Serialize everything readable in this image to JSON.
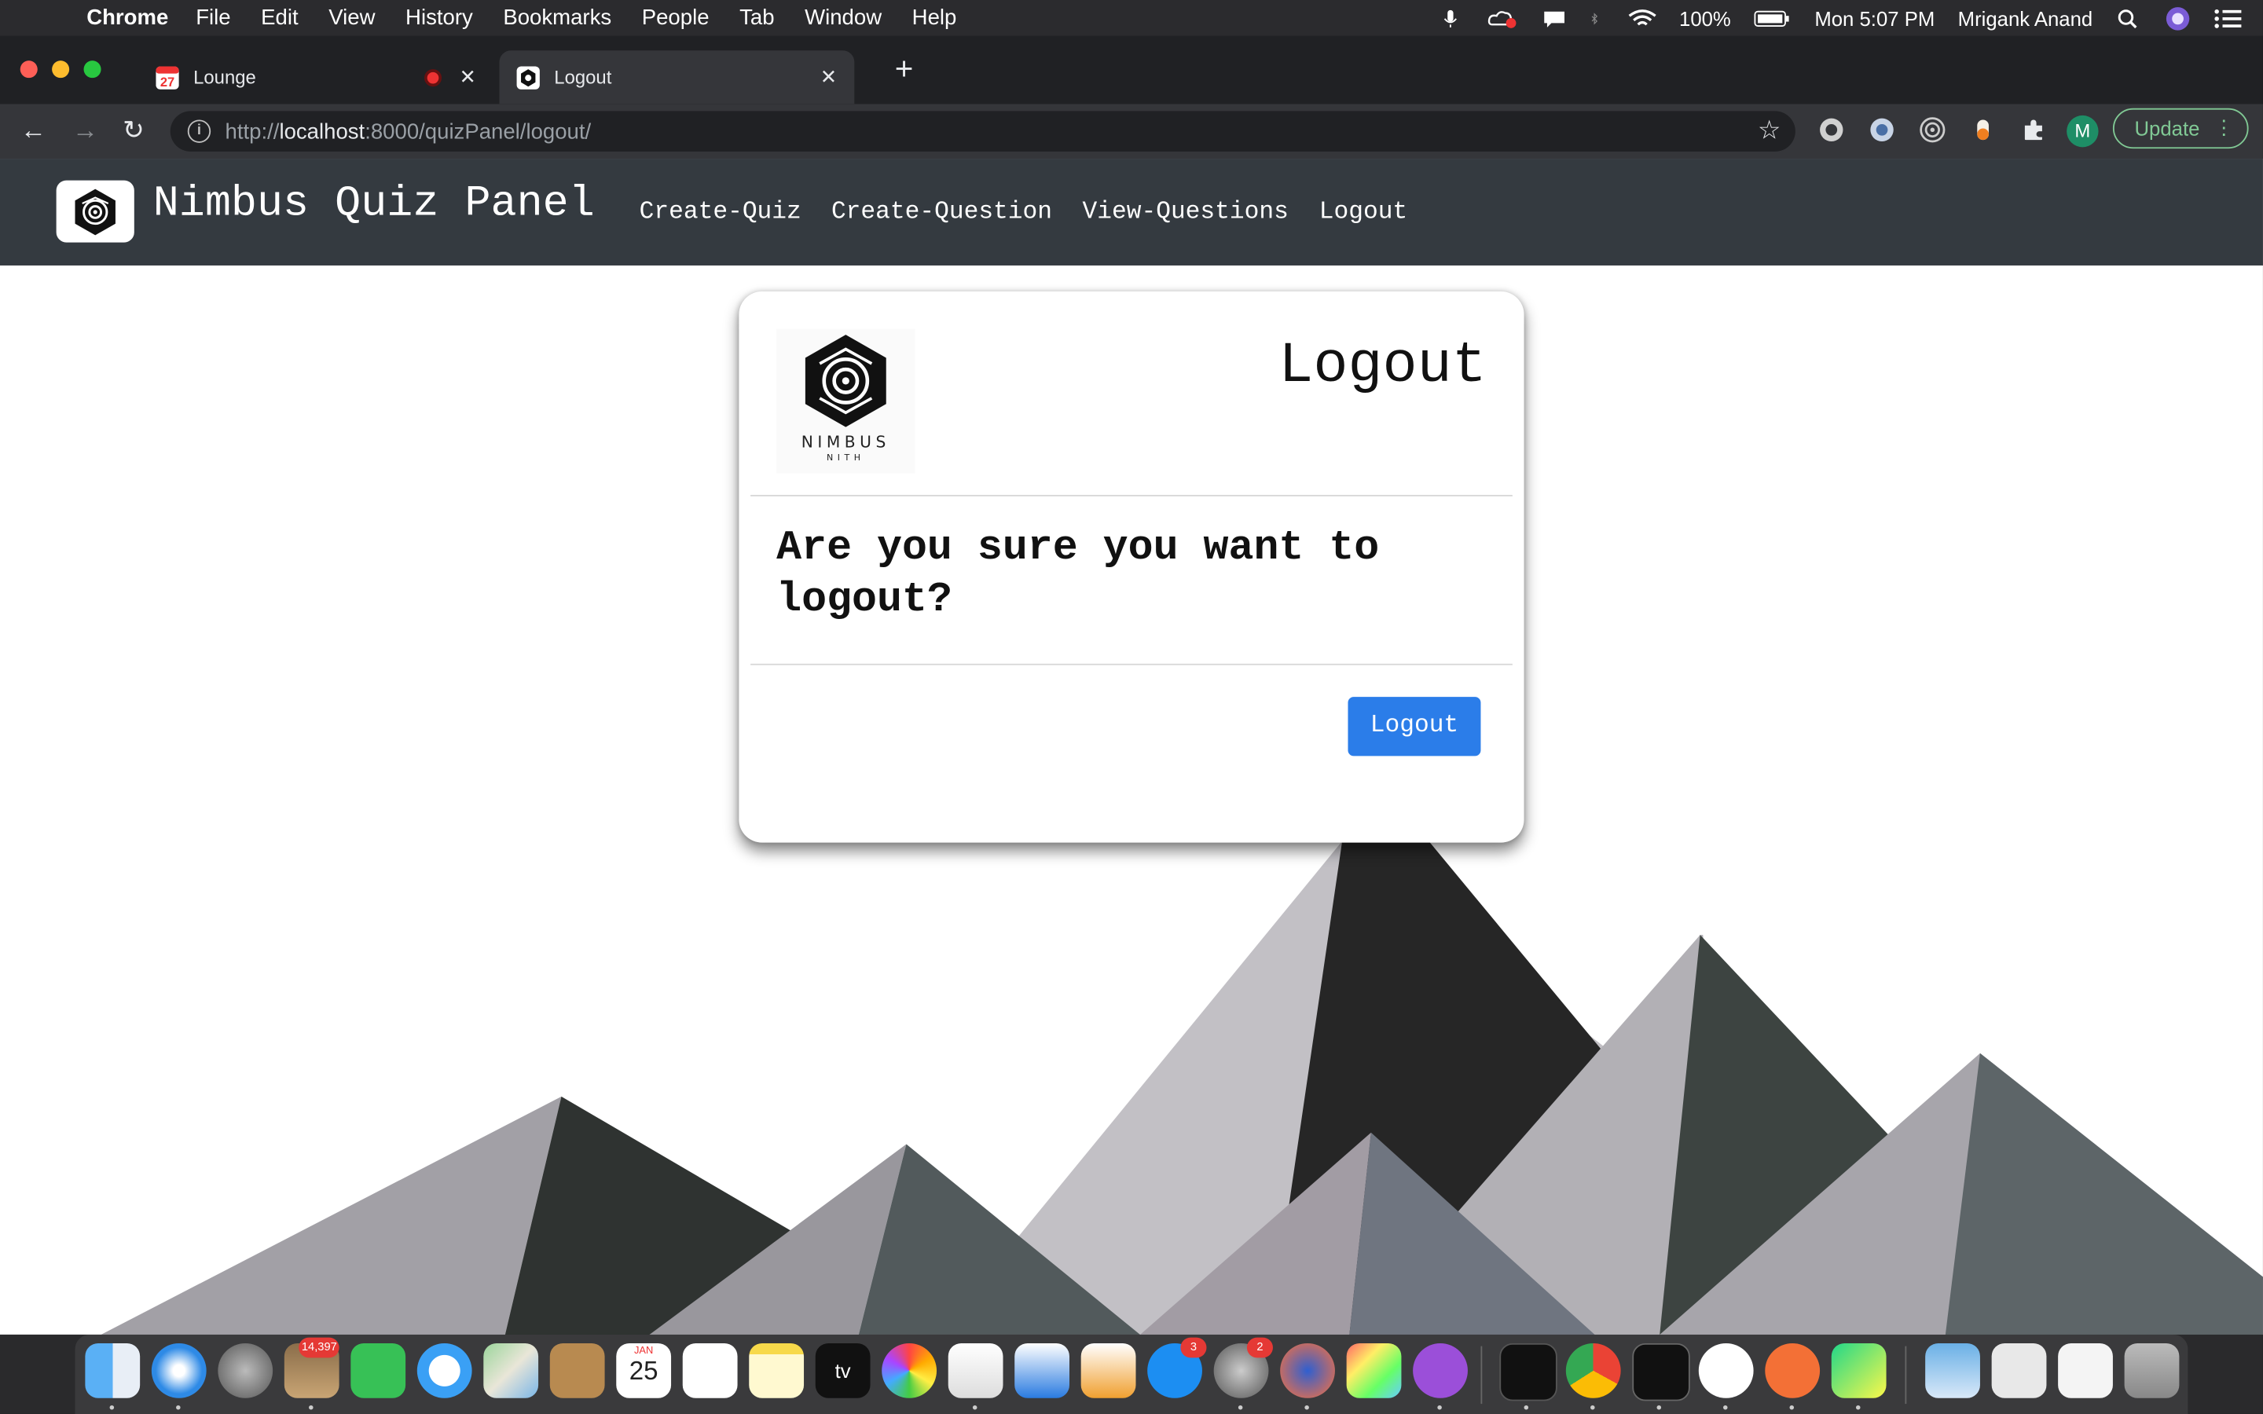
{
  "menubar": {
    "app": "Chrome",
    "items": [
      "File",
      "Edit",
      "View",
      "History",
      "Bookmarks",
      "People",
      "Tab",
      "Window",
      "Help"
    ],
    "battery": "100%",
    "clock": "Mon 5:07 PM",
    "user": "Mrigank Anand"
  },
  "tabs": [
    {
      "title": "Lounge",
      "favicon": "calendar-icon"
    },
    {
      "title": "Logout",
      "favicon": "nimbus-icon"
    }
  ],
  "toolbar": {
    "url_scheme": "http://",
    "url_host": "localhost",
    "url_path": ":8000/quizPanel/logout/",
    "profile_initial": "M",
    "update_label": "Update"
  },
  "navbar": {
    "brand": "Nimbus Quiz Panel",
    "links": [
      "Create-Quiz",
      "Create-Question",
      "View-Questions",
      "Logout"
    ]
  },
  "card": {
    "title": "Logout",
    "logo_text": "NIMBUS",
    "logo_subtext": "NITH",
    "message": "Are you sure you want to logout?",
    "button": "Logout"
  },
  "dock": {
    "mail_badge": "14,397",
    "calendar_month": "JAN",
    "calendar_day": "25",
    "appstore_badge": "3",
    "settings_badge": "2",
    "tv_label": "tv"
  },
  "colors": {
    "navbar": "#343a40",
    "primary_button": "#2b7de9",
    "chrome_dark": "#202124"
  }
}
